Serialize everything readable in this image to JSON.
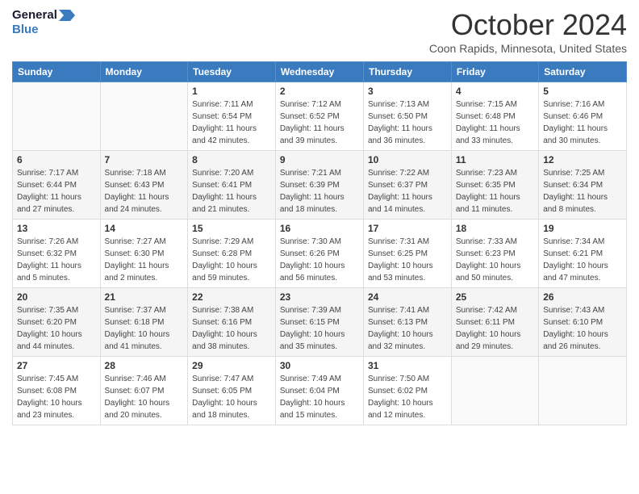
{
  "header": {
    "logo_line1": "General",
    "logo_line2": "Blue",
    "month_title": "October 2024",
    "location": "Coon Rapids, Minnesota, United States"
  },
  "days_of_week": [
    "Sunday",
    "Monday",
    "Tuesday",
    "Wednesday",
    "Thursday",
    "Friday",
    "Saturday"
  ],
  "weeks": [
    [
      {
        "day": "",
        "info": ""
      },
      {
        "day": "",
        "info": ""
      },
      {
        "day": "1",
        "info": "Sunrise: 7:11 AM\nSunset: 6:54 PM\nDaylight: 11 hours and 42 minutes."
      },
      {
        "day": "2",
        "info": "Sunrise: 7:12 AM\nSunset: 6:52 PM\nDaylight: 11 hours and 39 minutes."
      },
      {
        "day": "3",
        "info": "Sunrise: 7:13 AM\nSunset: 6:50 PM\nDaylight: 11 hours and 36 minutes."
      },
      {
        "day": "4",
        "info": "Sunrise: 7:15 AM\nSunset: 6:48 PM\nDaylight: 11 hours and 33 minutes."
      },
      {
        "day": "5",
        "info": "Sunrise: 7:16 AM\nSunset: 6:46 PM\nDaylight: 11 hours and 30 minutes."
      }
    ],
    [
      {
        "day": "6",
        "info": "Sunrise: 7:17 AM\nSunset: 6:44 PM\nDaylight: 11 hours and 27 minutes."
      },
      {
        "day": "7",
        "info": "Sunrise: 7:18 AM\nSunset: 6:43 PM\nDaylight: 11 hours and 24 minutes."
      },
      {
        "day": "8",
        "info": "Sunrise: 7:20 AM\nSunset: 6:41 PM\nDaylight: 11 hours and 21 minutes."
      },
      {
        "day": "9",
        "info": "Sunrise: 7:21 AM\nSunset: 6:39 PM\nDaylight: 11 hours and 18 minutes."
      },
      {
        "day": "10",
        "info": "Sunrise: 7:22 AM\nSunset: 6:37 PM\nDaylight: 11 hours and 14 minutes."
      },
      {
        "day": "11",
        "info": "Sunrise: 7:23 AM\nSunset: 6:35 PM\nDaylight: 11 hours and 11 minutes."
      },
      {
        "day": "12",
        "info": "Sunrise: 7:25 AM\nSunset: 6:34 PM\nDaylight: 11 hours and 8 minutes."
      }
    ],
    [
      {
        "day": "13",
        "info": "Sunrise: 7:26 AM\nSunset: 6:32 PM\nDaylight: 11 hours and 5 minutes."
      },
      {
        "day": "14",
        "info": "Sunrise: 7:27 AM\nSunset: 6:30 PM\nDaylight: 11 hours and 2 minutes."
      },
      {
        "day": "15",
        "info": "Sunrise: 7:29 AM\nSunset: 6:28 PM\nDaylight: 10 hours and 59 minutes."
      },
      {
        "day": "16",
        "info": "Sunrise: 7:30 AM\nSunset: 6:26 PM\nDaylight: 10 hours and 56 minutes."
      },
      {
        "day": "17",
        "info": "Sunrise: 7:31 AM\nSunset: 6:25 PM\nDaylight: 10 hours and 53 minutes."
      },
      {
        "day": "18",
        "info": "Sunrise: 7:33 AM\nSunset: 6:23 PM\nDaylight: 10 hours and 50 minutes."
      },
      {
        "day": "19",
        "info": "Sunrise: 7:34 AM\nSunset: 6:21 PM\nDaylight: 10 hours and 47 minutes."
      }
    ],
    [
      {
        "day": "20",
        "info": "Sunrise: 7:35 AM\nSunset: 6:20 PM\nDaylight: 10 hours and 44 minutes."
      },
      {
        "day": "21",
        "info": "Sunrise: 7:37 AM\nSunset: 6:18 PM\nDaylight: 10 hours and 41 minutes."
      },
      {
        "day": "22",
        "info": "Sunrise: 7:38 AM\nSunset: 6:16 PM\nDaylight: 10 hours and 38 minutes."
      },
      {
        "day": "23",
        "info": "Sunrise: 7:39 AM\nSunset: 6:15 PM\nDaylight: 10 hours and 35 minutes."
      },
      {
        "day": "24",
        "info": "Sunrise: 7:41 AM\nSunset: 6:13 PM\nDaylight: 10 hours and 32 minutes."
      },
      {
        "day": "25",
        "info": "Sunrise: 7:42 AM\nSunset: 6:11 PM\nDaylight: 10 hours and 29 minutes."
      },
      {
        "day": "26",
        "info": "Sunrise: 7:43 AM\nSunset: 6:10 PM\nDaylight: 10 hours and 26 minutes."
      }
    ],
    [
      {
        "day": "27",
        "info": "Sunrise: 7:45 AM\nSunset: 6:08 PM\nDaylight: 10 hours and 23 minutes."
      },
      {
        "day": "28",
        "info": "Sunrise: 7:46 AM\nSunset: 6:07 PM\nDaylight: 10 hours and 20 minutes."
      },
      {
        "day": "29",
        "info": "Sunrise: 7:47 AM\nSunset: 6:05 PM\nDaylight: 10 hours and 18 minutes."
      },
      {
        "day": "30",
        "info": "Sunrise: 7:49 AM\nSunset: 6:04 PM\nDaylight: 10 hours and 15 minutes."
      },
      {
        "day": "31",
        "info": "Sunrise: 7:50 AM\nSunset: 6:02 PM\nDaylight: 10 hours and 12 minutes."
      },
      {
        "day": "",
        "info": ""
      },
      {
        "day": "",
        "info": ""
      }
    ]
  ]
}
